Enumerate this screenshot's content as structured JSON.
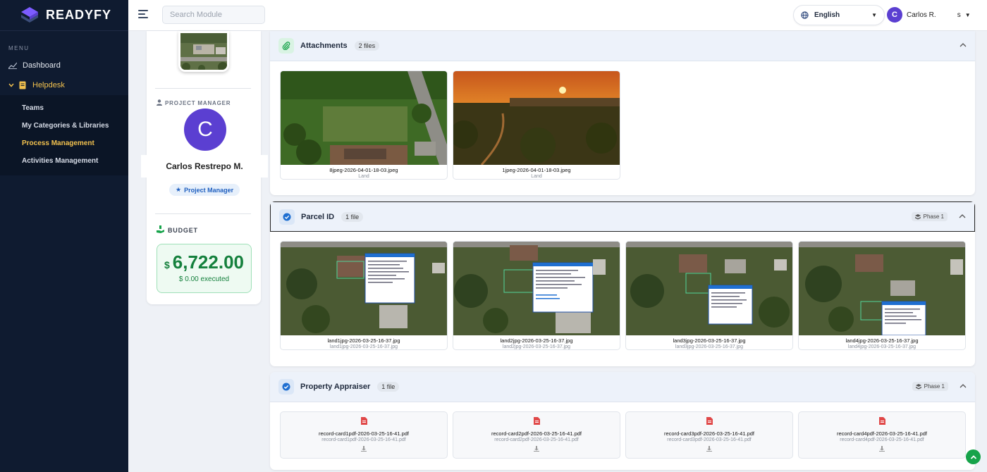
{
  "brand": {
    "name": "READYFY"
  },
  "sidebar": {
    "menu_heading": "MENU",
    "dashboard": "Dashboard",
    "helpdesk": "Helpdesk",
    "subitems": [
      "Teams",
      "My Categories & Libraries",
      "Process Management",
      "Activities Management"
    ],
    "active_subitem": "Process Management"
  },
  "topbar": {
    "search_placeholder": "Search Module",
    "language": "English",
    "user_initial": "C",
    "user_name": "Carlos R.",
    "user_suffix": "s"
  },
  "profile": {
    "manager_label": "PROJECT MANAGER",
    "avatar_initial": "C",
    "name": "Carlos Restrepo M.",
    "role": "Project Manager",
    "budget_label": "BUDGET",
    "budget_currency": "$",
    "budget_amount": "6,722.00",
    "budget_executed": "$ 0.00 executed"
  },
  "sections": {
    "attachments": {
      "title": "Attachments",
      "count": "2 files",
      "files": [
        {
          "name": "8jpeg-2026-04-01-18-03.jpeg",
          "sub": "Land"
        },
        {
          "name": "1jpeg-2026-04-01-18-03.jpeg",
          "sub": "Land"
        }
      ]
    },
    "parcel": {
      "title": "Parcel ID",
      "count": "1 file",
      "phase": "Phase 1",
      "files": [
        {
          "name": "land1jpg-2026-03-25-16-37.jpg",
          "sub": "land1jpg-2026-03-25-16-37.jpg"
        },
        {
          "name": "land2jpg-2026-03-25-16-37.jpg",
          "sub": "land2jpg-2026-03-25-16-37.jpg"
        },
        {
          "name": "land3jpg-2026-03-25-16-37.jpg",
          "sub": "land3jpg-2026-03-25-16-37.jpg"
        },
        {
          "name": "land4jpg-2026-03-25-16-37.jpg",
          "sub": "land4jpg-2026-03-25-16-37.jpg"
        }
      ]
    },
    "appraiser": {
      "title": "Property Appraiser",
      "count": "1 file",
      "phase": "Phase 1",
      "files": [
        {
          "name": "record-card1pdf-2026-03-25-16-41.pdf",
          "sub": "record-card1pdf-2026-03-25-16-41.pdf"
        },
        {
          "name": "record-card2pdf-2026-03-25-16-41.pdf",
          "sub": "record-card2pdf-2026-03-25-16-41.pdf"
        },
        {
          "name": "record-card3pdf-2026-03-25-16-41.pdf",
          "sub": "record-card3pdf-2026-03-25-16-41.pdf"
        },
        {
          "name": "record-card4pdf-2026-03-25-16-41.pdf",
          "sub": "record-card4pdf-2026-03-25-16-41.pdf"
        }
      ]
    }
  },
  "colors": {
    "sidebar": "#0f1b30",
    "accent": "#f2c14e",
    "avatar": "#5b3fd1",
    "budget": "#15803d"
  }
}
